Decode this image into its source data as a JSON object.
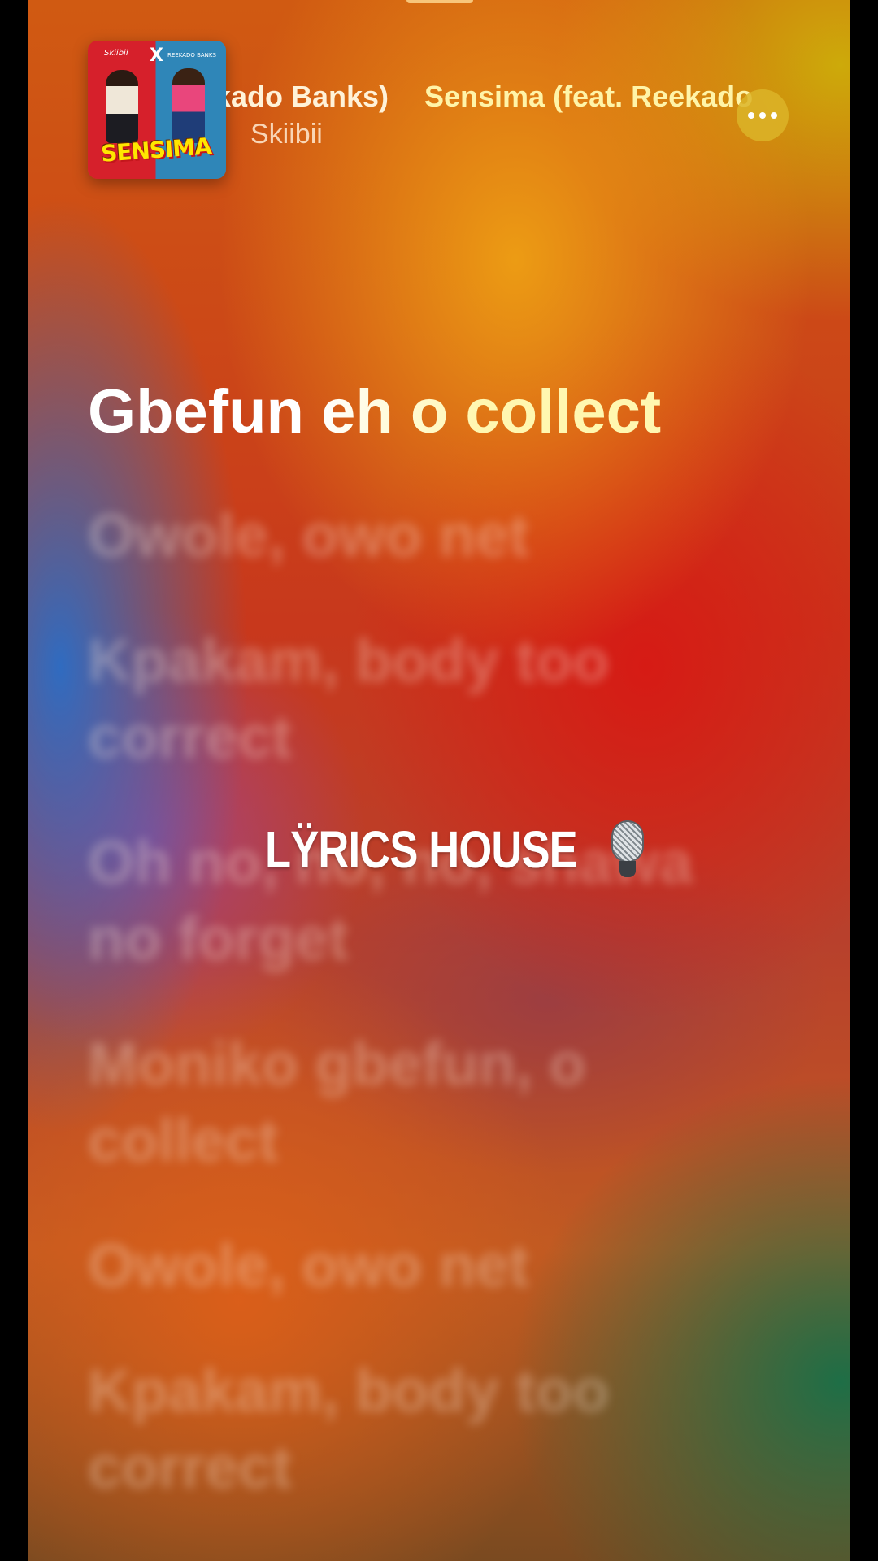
{
  "now_playing": {
    "song_title": "Sensima (feat. Reekado Banks)",
    "artist": "Skiibii",
    "album_art_title": "SENSIMA",
    "album_art_left_name": "Skiibii",
    "album_art_right_name": "REEKADO BANKS",
    "album_art_x": "X",
    "more_button_label": "More options"
  },
  "lyrics": {
    "active_line": "Gbefun eh o collect",
    "upcoming_lines": [
      "Owole, owo net",
      "Kpakam, body too correct",
      "Oh no, no, no, shawa no forget",
      "Moniko gbefun, o collect",
      "Owole, owo net",
      "Kpakam, body too correct"
    ]
  },
  "watermark": {
    "text": "LŸRICS HOUSE",
    "icon": "microphone-icon"
  },
  "colors": {
    "active_lyric": "#fff7b0",
    "title_text": "#fff4a8",
    "more_button": "#dcb428"
  }
}
